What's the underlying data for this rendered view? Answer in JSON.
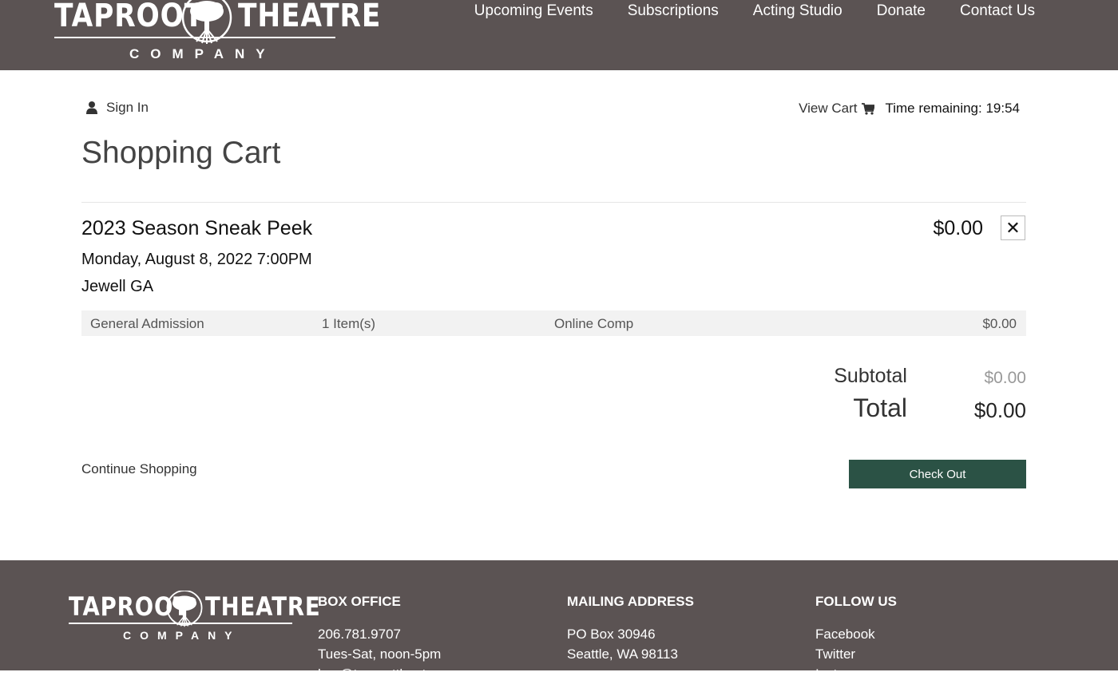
{
  "header": {
    "logo": {
      "word_left": "TAPROOT",
      "word_right": "THEATRE",
      "subtitle": "COMPANY"
    },
    "nav": [
      {
        "label": "Upcoming Events"
      },
      {
        "label": "Subscriptions"
      },
      {
        "label": "Acting Studio"
      },
      {
        "label": "Donate"
      },
      {
        "label": "Contact Us"
      }
    ]
  },
  "account": {
    "sign_in_label": "Sign In",
    "sign_in_icon": "user-icon"
  },
  "cart_bar": {
    "view_cart_label": "View Cart",
    "cart_icon": "cart-icon",
    "time_remaining": "Time remaining: 19:54"
  },
  "page": {
    "title": "Shopping Cart"
  },
  "cart_item": {
    "event_name": "2023 Season Sneak Peek",
    "date_time": "Monday, August 8, 2022 7:00PM",
    "venue": "Jewell GA",
    "price": "$0.00",
    "remove_symbol": "✕",
    "line": {
      "ticket_type": "General Admission",
      "quantity": "1 Item(s)",
      "price_type": "Online Comp",
      "amount": "$0.00"
    }
  },
  "totals": {
    "subtotal_label": "Subtotal",
    "subtotal_value": "$0.00",
    "total_label": "Total",
    "total_value": "$0.00"
  },
  "actions": {
    "continue_label": "Continue Shopping",
    "checkout_label": "Check Out"
  },
  "colors": {
    "header_bg": "#5b5353",
    "checkout_bg": "#2b5245",
    "row_bg": "#f2f2f2"
  },
  "footer": {
    "logo": {
      "word_left": "TAPROOT",
      "word_right": "THEATRE",
      "subtitle": "COMPANY"
    },
    "box_office": {
      "heading": "BOX OFFICE",
      "phone": "206.781.9707",
      "hours": "Tues-Sat, noon-5pm",
      "email": "box@taproottheatre.org"
    },
    "mailing": {
      "heading": "MAILING ADDRESS",
      "line1": "PO Box 30946",
      "line2": "Seattle, WA 98113"
    },
    "follow": {
      "heading": "FOLLOW US",
      "links": [
        "Facebook",
        "Twitter",
        "Instagram"
      ]
    }
  }
}
